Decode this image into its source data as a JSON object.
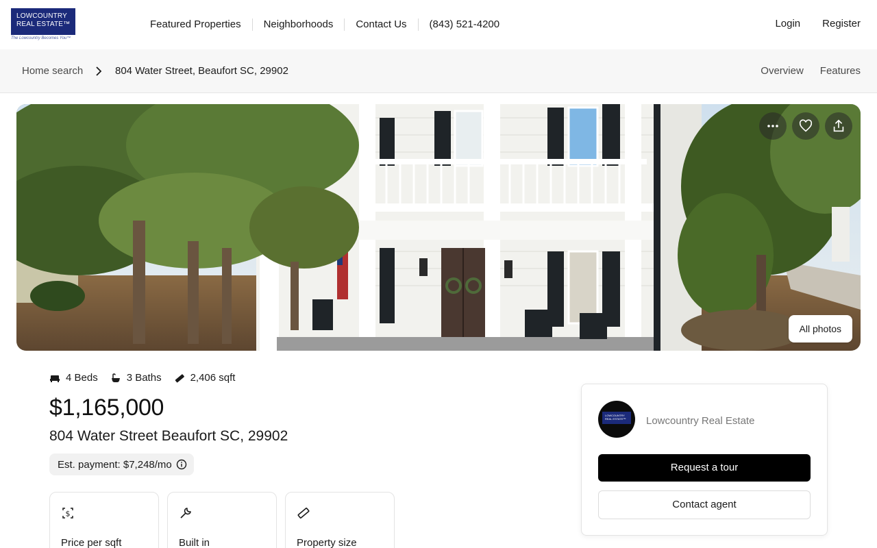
{
  "header": {
    "logo": {
      "line1": "LOWCOUNTRY",
      "line2": "REAL ESTATE™",
      "tagline": "The Lowcountry Becomes You™"
    },
    "nav": [
      "Featured Properties",
      "Neighborhoods",
      "Contact Us",
      "(843) 521-4200"
    ],
    "auth": {
      "login": "Login",
      "register": "Register"
    }
  },
  "breadcrumb": {
    "home": "Home search",
    "current": "804 Water Street, Beaufort SC, 29902",
    "tabs": [
      "Overview",
      "Features"
    ]
  },
  "hero": {
    "all_photos_label": "All photos",
    "icons": [
      "more-icon",
      "heart-icon",
      "share-icon"
    ]
  },
  "listing": {
    "beds": "4 Beds",
    "baths": "3 Baths",
    "sqft": "2,406 sqft",
    "price": "$1,165,000",
    "address": "804 Water Street Beaufort SC, 29902",
    "est_payment": "Est. payment: $7,248/mo",
    "cards": [
      {
        "icon": "dollar-tag-icon",
        "label": "Price per sqft"
      },
      {
        "icon": "wrench-icon",
        "label": "Built in"
      },
      {
        "icon": "ruler-icon",
        "label": "Property size"
      }
    ]
  },
  "agent": {
    "name": "Lowcountry Real Estate",
    "request_tour": "Request a tour",
    "contact_agent": "Contact agent"
  },
  "colors": {
    "brand": "#1b2a7a",
    "primary_button": "#000000"
  }
}
